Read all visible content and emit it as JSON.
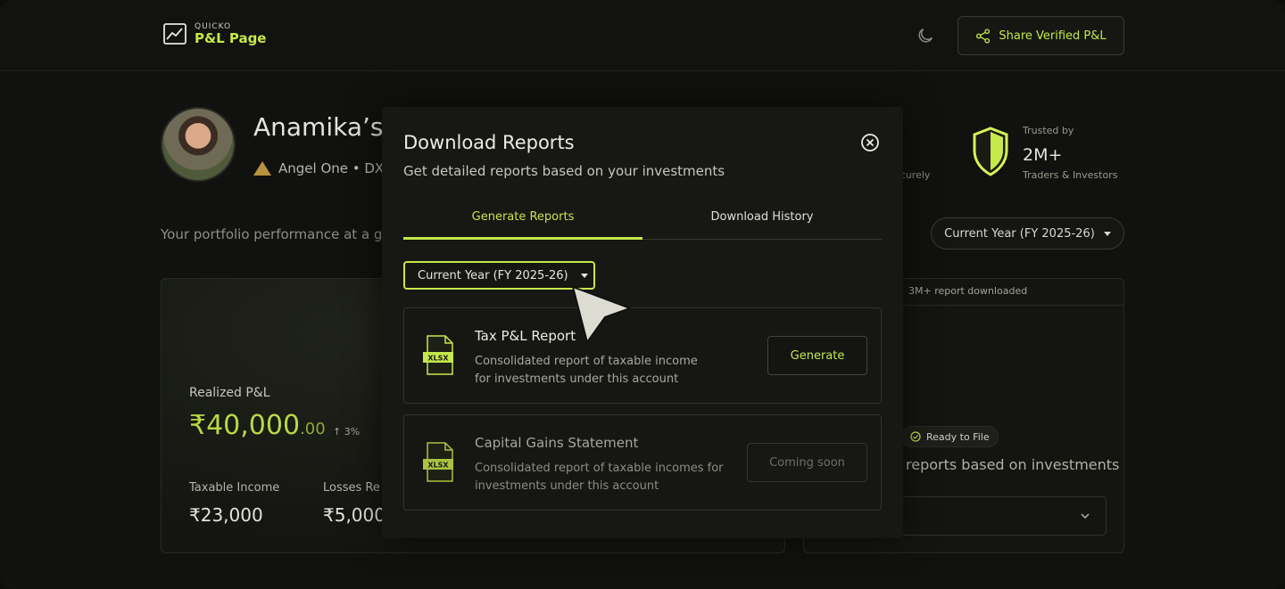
{
  "header": {
    "logo_small": "QUICKO",
    "logo_big": "P&L Page",
    "share_label": "Share Verified P&L"
  },
  "profile": {
    "name": "Anamika’s I",
    "broker": "Angel One • DX",
    "securely": "ecurely",
    "trusted_label": "Trusted by",
    "trusted_count": "2M+",
    "trusted_sub": "Traders & Investors",
    "portfolio_text": "Your portfolio performance at a gl",
    "year_select": "Current Year (FY 2025-26)"
  },
  "pl_card": {
    "label": "Realized P&L",
    "value": "₹40,000",
    "value_decimal": ".00",
    "change": "↑ 3%",
    "taxable_label": "Taxable Income",
    "taxable_value": "₹23,000",
    "losses_label": "Losses Re",
    "losses_value": "₹5,000"
  },
  "right_card": {
    "downloaded": "3M+ report downloaded",
    "ready_badge": "Ready to File",
    "text": "reports based on investments"
  },
  "modal": {
    "title": "Download Reports",
    "subtitle": "Get detailed reports based on your investments",
    "tabs": [
      {
        "label": "Generate Reports",
        "active": true
      },
      {
        "label": "Download History",
        "active": false
      }
    ],
    "year_select": "Current Year (FY 2025-26)",
    "reports": [
      {
        "title": "Tax P&L Report",
        "description": "Consolidated report of taxable income for investments under this account",
        "file_type": "XLSX",
        "action": "Generate"
      },
      {
        "title": "Capital Gains Statement",
        "description": "Consolidated report of taxable incomes for investments under this account",
        "file_type": "XLSX",
        "action": "Coming soon"
      }
    ]
  },
  "colors": {
    "accent": "#c5e84a",
    "background": "#11110f",
    "card": "#161613"
  },
  "icons": [
    "chart-logo-icon",
    "moon-icon",
    "share-icon",
    "shield-icon",
    "check-circle-icon",
    "chevron-down-icon",
    "close-icon",
    "xlsx-file-icon",
    "cursor-icon"
  ]
}
